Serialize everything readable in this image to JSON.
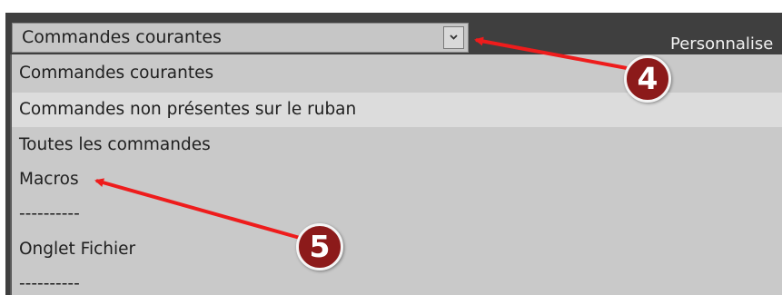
{
  "dropdown": {
    "selected": "Commandes courantes",
    "button_icon": "chevron-down-icon",
    "options": [
      "Commandes courantes",
      "Commandes non présentes sur le ruban",
      "Toutes les commandes",
      "Macros",
      "----------",
      "Onglet Fichier",
      "----------"
    ],
    "hovered_index": 1
  },
  "side_label": "Personnalise",
  "annotations": {
    "badge_4": "4",
    "badge_5": "5",
    "color": "#8c1a1a",
    "arrow_color": "#ee1c1c"
  }
}
